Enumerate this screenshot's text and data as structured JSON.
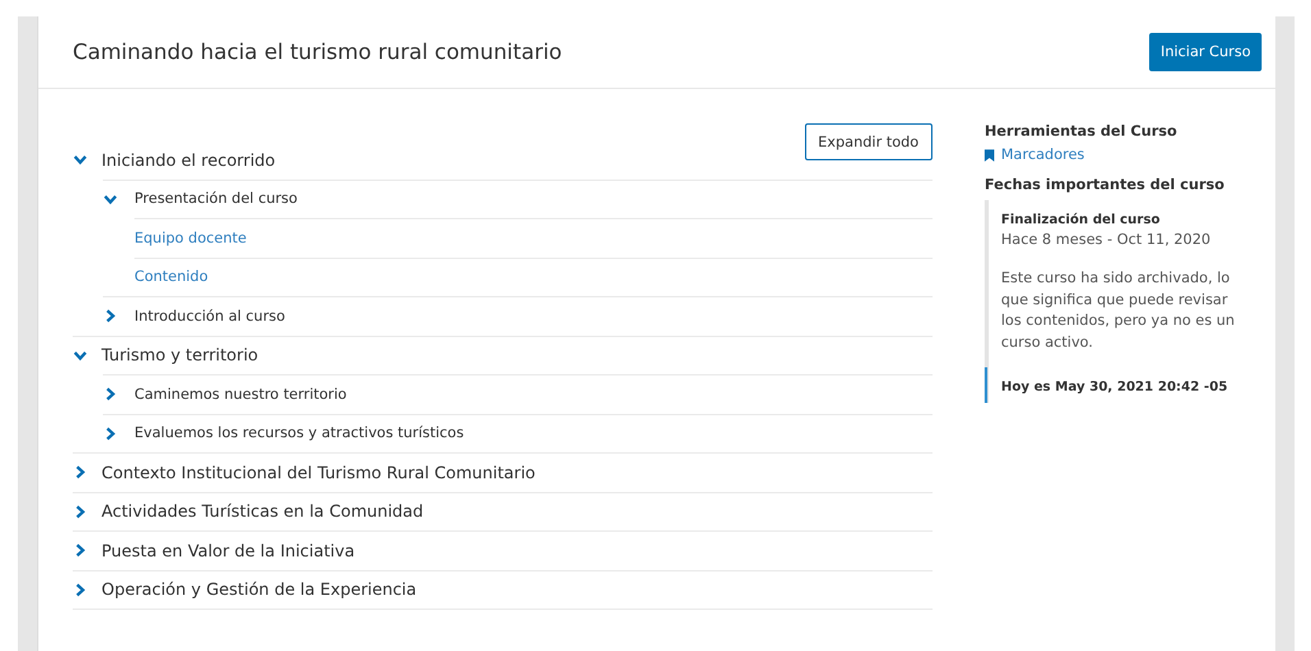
{
  "header": {
    "title": "Caminando hacia el turismo rural comunitario",
    "start_button": "Iniciar Curso"
  },
  "expand_all": "Expandir todo",
  "outline": [
    {
      "title": "Iniciando el recorrido",
      "expanded": true,
      "children": [
        {
          "title": "Presentación del curso",
          "expanded": true,
          "children": [
            {
              "title": "Equipo docente"
            },
            {
              "title": "Contenido"
            }
          ]
        },
        {
          "title": "Introducción al curso",
          "expanded": false
        }
      ]
    },
    {
      "title": "Turismo y territorio",
      "expanded": true,
      "children": [
        {
          "title": "Caminemos nuestro territorio",
          "expanded": false
        },
        {
          "title": "Evaluemos los recursos y atractivos turísticos",
          "expanded": false
        }
      ]
    },
    {
      "title": "Contexto Institucional del Turismo Rural Comunitario",
      "expanded": false
    },
    {
      "title": "Actividades Turísticas en la Comunidad",
      "expanded": false
    },
    {
      "title": "Puesta en Valor de la Iniciativa",
      "expanded": false
    },
    {
      "title": "Operación y Gestión de la Experiencia",
      "expanded": false
    }
  ],
  "sidebar": {
    "tools_heading": "Herramientas del Curso",
    "bookmarks": "Marcadores",
    "dates_heading": "Fechas importantes del curso",
    "dates": [
      {
        "kind": "past",
        "title": "Finalización del curso",
        "date": "Hace 8 meses - Oct 11, 2020",
        "note": "Este curso ha sido archivado, lo que significa que puede revisar los contenidos, pero ya no es un curso activo."
      },
      {
        "kind": "today",
        "title": "Hoy es May 30, 2021 20:42 -05"
      }
    ]
  }
}
